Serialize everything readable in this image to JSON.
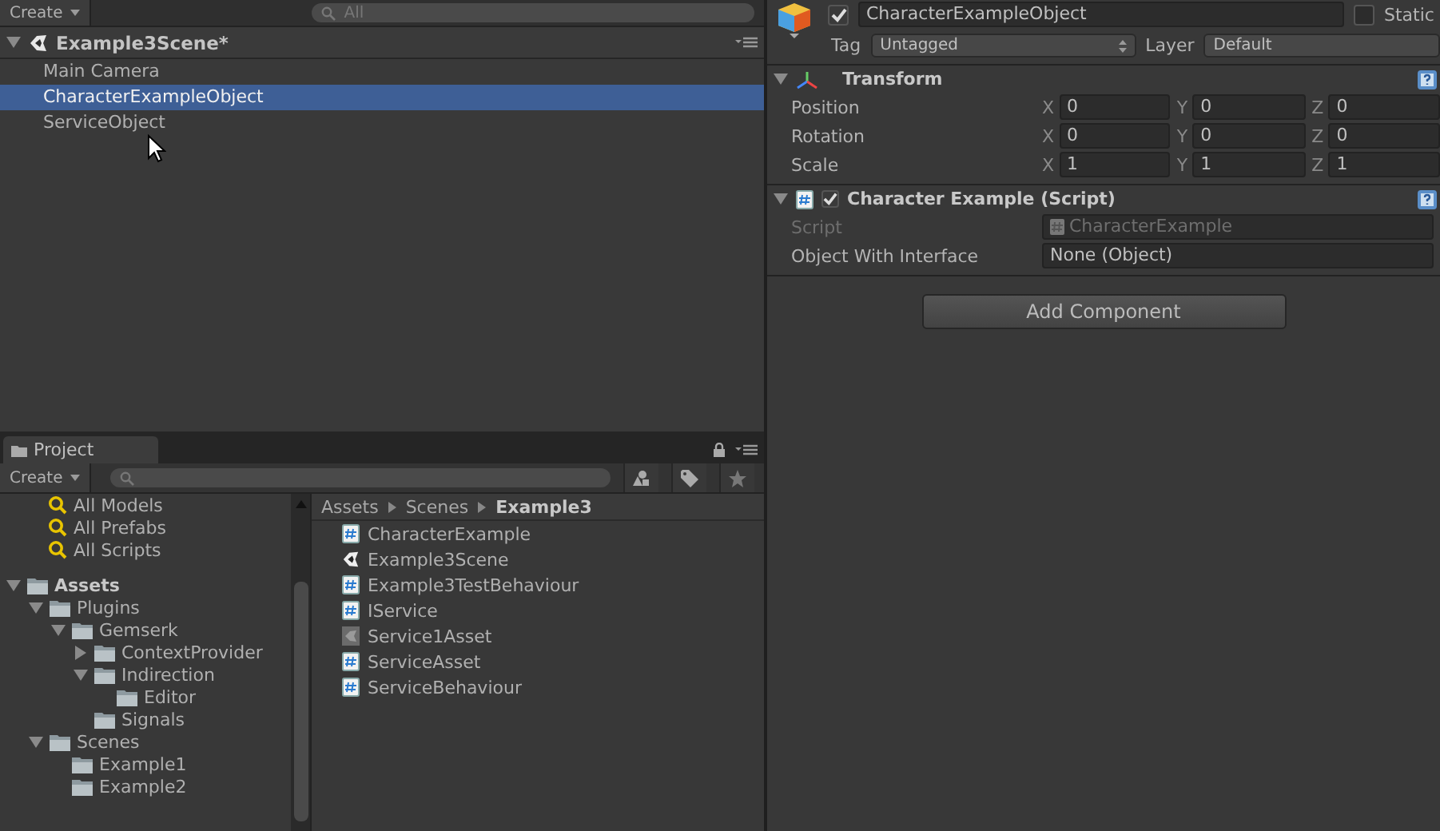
{
  "hierarchy": {
    "create_button": "Create",
    "search": {
      "placeholder": "All"
    },
    "scene": {
      "name": "Example3Scene*",
      "expanded": true
    },
    "items": [
      {
        "label": "Main Camera",
        "selected": false
      },
      {
        "label": "CharacterExampleObject",
        "selected": true
      },
      {
        "label": "ServiceObject",
        "selected": false
      }
    ]
  },
  "project": {
    "tab": "Project",
    "create_button": "Create",
    "favorites": [
      "All Models",
      "All Prefabs",
      "All Scripts"
    ],
    "tree": [
      {
        "label": "Assets",
        "expandable": true,
        "expanded": true,
        "children": [
          {
            "label": "Plugins",
            "expandable": true,
            "expanded": true,
            "children": [
              {
                "label": "Gemserk",
                "expandable": true,
                "expanded": true,
                "children": [
                  {
                    "label": "ContextProvider",
                    "expandable": true,
                    "expanded": false
                  },
                  {
                    "label": "Indirection",
                    "expandable": true,
                    "expanded": true,
                    "children": [
                      {
                        "label": "Editor",
                        "expandable": false,
                        "expanded": false
                      }
                    ]
                  },
                  {
                    "label": "Signals",
                    "expandable": false,
                    "expanded": false
                  }
                ]
              }
            ]
          },
          {
            "label": "Scenes",
            "expandable": true,
            "expanded": true,
            "children": [
              {
                "label": "Example1",
                "expandable": false,
                "expanded": false
              },
              {
                "label": "Example2",
                "expandable": false,
                "expanded": false
              }
            ]
          }
        ]
      }
    ],
    "breadcrumb": [
      "Assets",
      "Scenes",
      "Example3"
    ],
    "files": [
      {
        "label": "CharacterExample",
        "kind": "script"
      },
      {
        "label": "Example3Scene",
        "kind": "scene"
      },
      {
        "label": "Example3TestBehaviour",
        "kind": "script"
      },
      {
        "label": "IService",
        "kind": "script"
      },
      {
        "label": "Service1Asset",
        "kind": "asset"
      },
      {
        "label": "ServiceAsset",
        "kind": "script"
      },
      {
        "label": "ServiceBehaviour",
        "kind": "script"
      }
    ]
  },
  "inspector": {
    "active": true,
    "name": "CharacterExampleObject",
    "static": {
      "label": "Static",
      "checked": false
    },
    "tag": {
      "label": "Tag",
      "value": "Untagged"
    },
    "layer": {
      "label": "Layer",
      "value": "Default"
    },
    "components": [
      {
        "kind": "transform",
        "title": "Transform",
        "expanded": true,
        "rows": [
          {
            "label": "Position",
            "fields": [
              {
                "axis": "X",
                "value": "0"
              },
              {
                "axis": "Y",
                "value": "0"
              },
              {
                "axis": "Z",
                "value": "0"
              }
            ]
          },
          {
            "label": "Rotation",
            "fields": [
              {
                "axis": "X",
                "value": "0"
              },
              {
                "axis": "Y",
                "value": "0"
              },
              {
                "axis": "Z",
                "value": "0"
              }
            ]
          },
          {
            "label": "Scale",
            "fields": [
              {
                "axis": "X",
                "value": "1"
              },
              {
                "axis": "Y",
                "value": "1"
              },
              {
                "axis": "Z",
                "value": "1"
              }
            ]
          }
        ]
      },
      {
        "kind": "script",
        "title": "Character Example (Script)",
        "expanded": true,
        "enabled": true,
        "properties": [
          {
            "label": "Script",
            "value": "CharacterExample",
            "disabled": true
          },
          {
            "label": "Object With Interface",
            "value": "None (Object)",
            "disabled": false
          }
        ]
      }
    ],
    "add_button": "Add Component"
  }
}
